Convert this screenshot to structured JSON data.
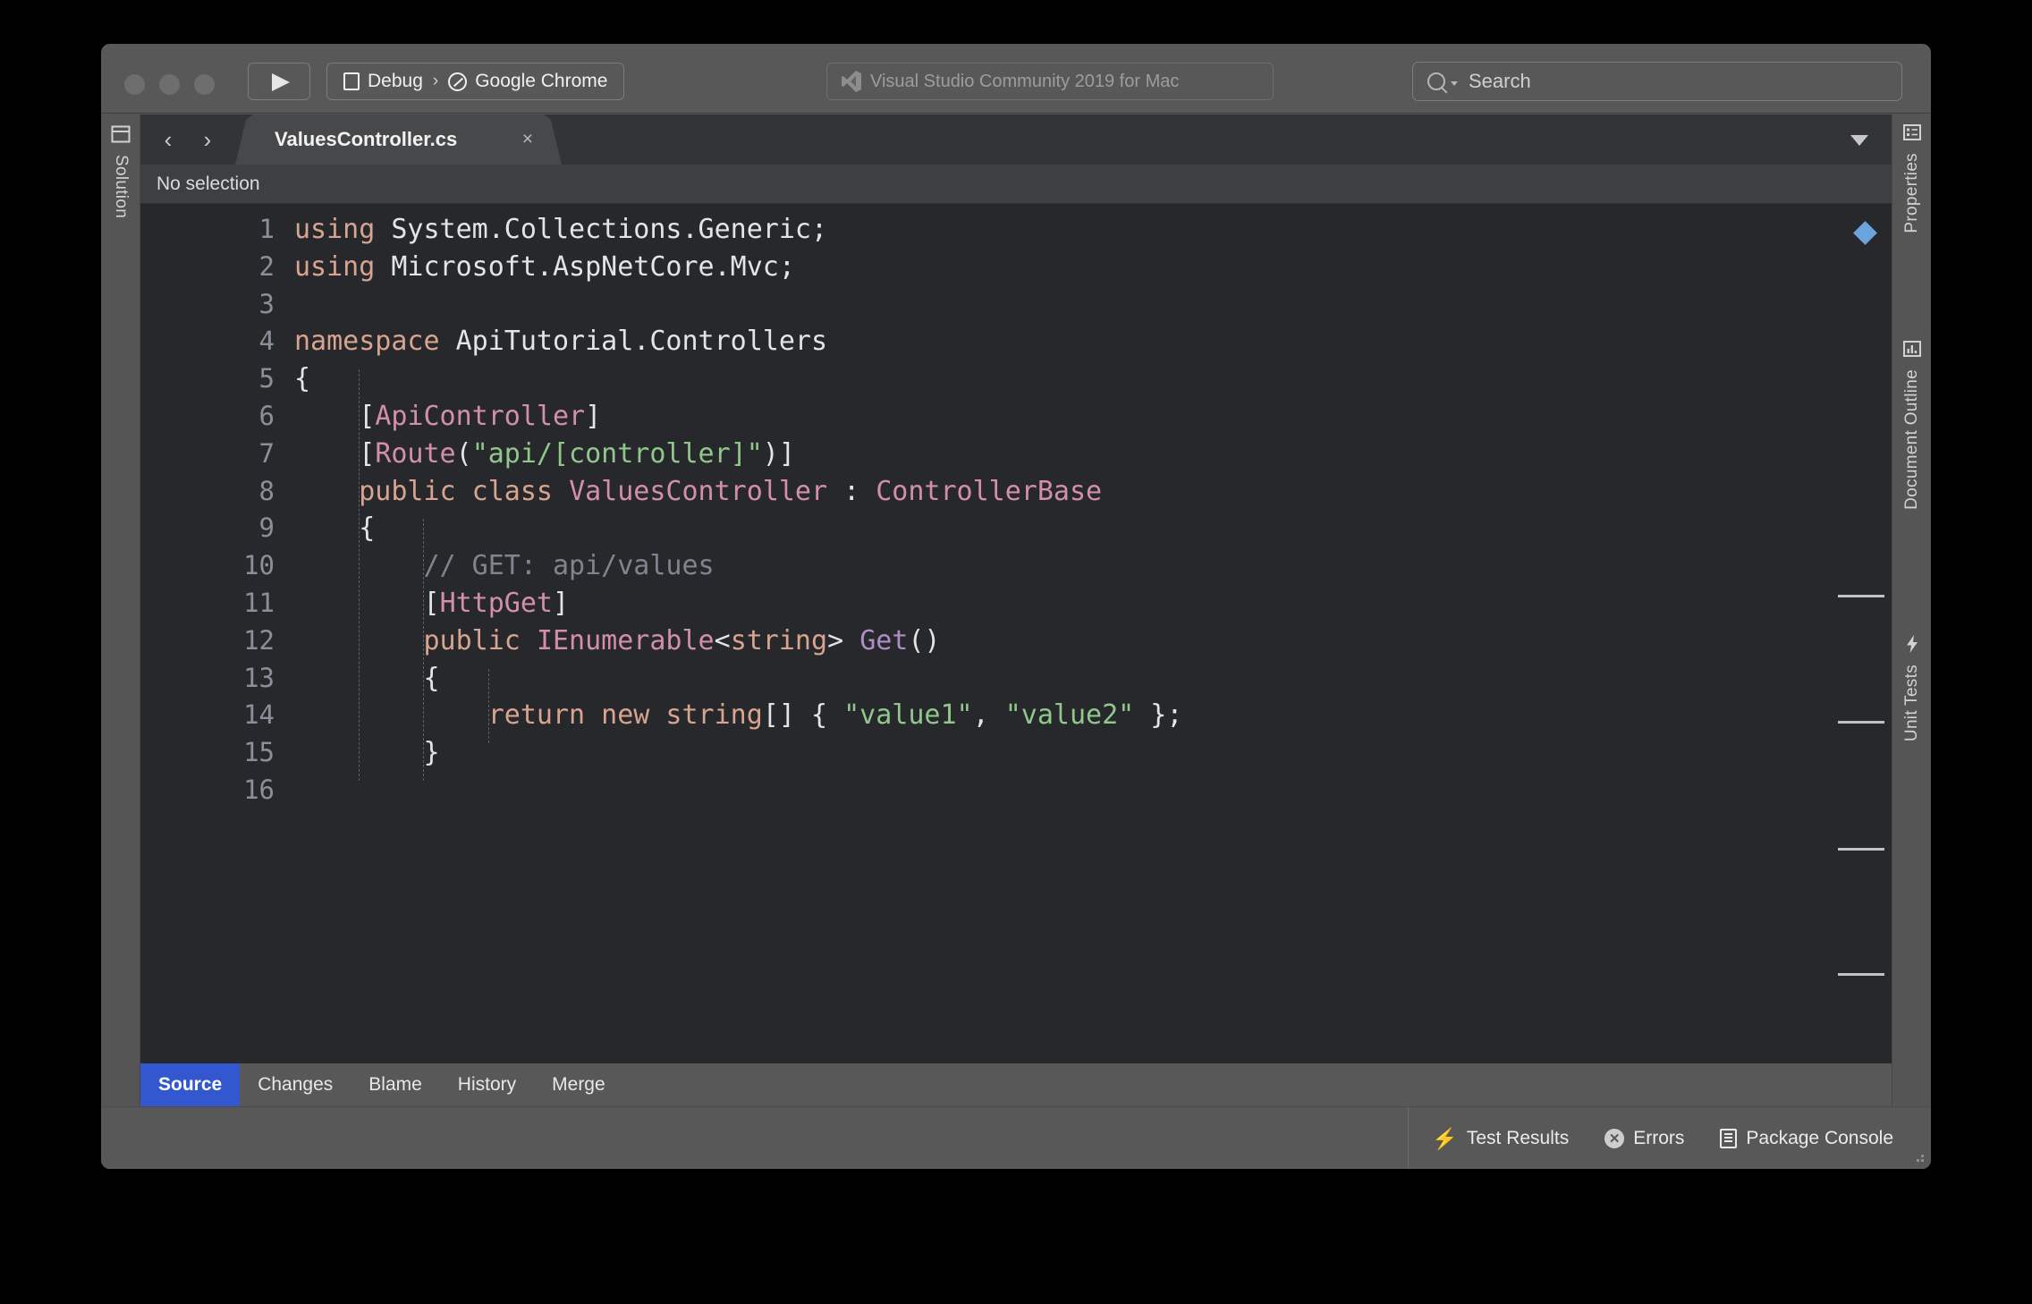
{
  "window": {
    "titlebar": {
      "traffic_lights": [
        "close",
        "minimize",
        "zoom"
      ],
      "run_button_icon": "play-icon",
      "run_target": {
        "configuration": "Debug",
        "separator": "›",
        "device": "Google Chrome"
      },
      "app_title": "Visual Studio Community 2019 for Mac",
      "search_placeholder": "Search"
    }
  },
  "left_pad": {
    "items": [
      {
        "label": "Solution",
        "icon": "solution-panel-icon"
      }
    ]
  },
  "right_pad": {
    "items": [
      {
        "label": "Properties",
        "icon": "properties-panel-icon"
      },
      {
        "label": "Document Outline",
        "icon": "document-outline-icon"
      },
      {
        "label": "Unit Tests",
        "icon": "unit-tests-bolt-icon"
      }
    ]
  },
  "tabbar": {
    "nav_back": "‹",
    "nav_forward": "›",
    "file_tab": "ValuesController.cs",
    "close_glyph": "×",
    "dropdown_icon": "chevron-down-icon"
  },
  "breadcrumb": {
    "text": "No selection"
  },
  "editor": {
    "first_line": 1,
    "lines": [
      {
        "n": 1,
        "tokens": [
          {
            "t": "using ",
            "c": "kw"
          },
          {
            "t": "System.Collections.Generic;",
            "c": "pln"
          }
        ]
      },
      {
        "n": 2,
        "tokens": [
          {
            "t": "using ",
            "c": "kw"
          },
          {
            "t": "Microsoft.AspNetCore.Mvc;",
            "c": "pln"
          }
        ]
      },
      {
        "n": 3,
        "tokens": []
      },
      {
        "n": 4,
        "tokens": [
          {
            "t": "namespace ",
            "c": "kw"
          },
          {
            "t": "ApiTutorial.Controllers",
            "c": "pln"
          }
        ]
      },
      {
        "n": 5,
        "tokens": [
          {
            "t": "{",
            "c": "pln"
          }
        ]
      },
      {
        "n": 6,
        "tokens": [
          {
            "t": "    [",
            "c": "pln"
          },
          {
            "t": "ApiController",
            "c": "typ"
          },
          {
            "t": "]",
            "c": "pln"
          }
        ]
      },
      {
        "n": 7,
        "tokens": [
          {
            "t": "    [",
            "c": "pln"
          },
          {
            "t": "Route",
            "c": "typ"
          },
          {
            "t": "(",
            "c": "pln"
          },
          {
            "t": "\"api/[controller]\"",
            "c": "str"
          },
          {
            "t": ")]",
            "c": "pln"
          }
        ]
      },
      {
        "n": 8,
        "tokens": [
          {
            "t": "    ",
            "c": "pln"
          },
          {
            "t": "public class ",
            "c": "kw"
          },
          {
            "t": "ValuesController",
            "c": "typ"
          },
          {
            "t": " : ",
            "c": "pln"
          },
          {
            "t": "ControllerBase",
            "c": "typ"
          }
        ]
      },
      {
        "n": 9,
        "tokens": [
          {
            "t": "    {",
            "c": "pln"
          }
        ]
      },
      {
        "n": 10,
        "tokens": [
          {
            "t": "        // GET: api/values",
            "c": "cmt"
          }
        ]
      },
      {
        "n": 11,
        "tokens": [
          {
            "t": "        [",
            "c": "pln"
          },
          {
            "t": "HttpGet",
            "c": "typ"
          },
          {
            "t": "]",
            "c": "pln"
          }
        ]
      },
      {
        "n": 12,
        "tokens": [
          {
            "t": "        ",
            "c": "pln"
          },
          {
            "t": "public ",
            "c": "kw"
          },
          {
            "t": "IEnumerable",
            "c": "typ"
          },
          {
            "t": "<",
            "c": "pln"
          },
          {
            "t": "string",
            "c": "kw"
          },
          {
            "t": "> ",
            "c": "pln"
          },
          {
            "t": "Get",
            "c": "mth"
          },
          {
            "t": "()",
            "c": "pln"
          }
        ]
      },
      {
        "n": 13,
        "tokens": [
          {
            "t": "        {",
            "c": "pln"
          }
        ]
      },
      {
        "n": 14,
        "tokens": [
          {
            "t": "            ",
            "c": "pln"
          },
          {
            "t": "return new string",
            "c": "kw"
          },
          {
            "t": "[] { ",
            "c": "pln"
          },
          {
            "t": "\"value1\"",
            "c": "str"
          },
          {
            "t": ", ",
            "c": "pln"
          },
          {
            "t": "\"value2\"",
            "c": "str"
          },
          {
            "t": " };",
            "c": "pln"
          }
        ]
      },
      {
        "n": 15,
        "tokens": [
          {
            "t": "        }",
            "c": "pln"
          }
        ]
      },
      {
        "n": 16,
        "tokens": []
      }
    ],
    "markers": {
      "bookmark_icon": "blue-diamond-marker",
      "change_bars": 4
    }
  },
  "bottom_tabs": {
    "items": [
      {
        "label": "Source",
        "active": true
      },
      {
        "label": "Changes",
        "active": false
      },
      {
        "label": "Blame",
        "active": false
      },
      {
        "label": "History",
        "active": false
      },
      {
        "label": "Merge",
        "active": false
      }
    ]
  },
  "status_bar": {
    "items": [
      {
        "label": "Test Results",
        "icon": "bolt-icon"
      },
      {
        "label": "Errors",
        "icon": "error-circle-icon"
      },
      {
        "label": "Package Console",
        "icon": "console-icon"
      }
    ]
  },
  "colors": {
    "accent_blue": "#3357cf",
    "marker_blue": "#6ba3dd",
    "editor_bg": "#26282c",
    "chrome_bg": "#585858",
    "keyword": "#d8a48f",
    "type": "#d38fa8",
    "string": "#92c78c",
    "comment": "#7e858e",
    "method": "#b08cc4"
  }
}
